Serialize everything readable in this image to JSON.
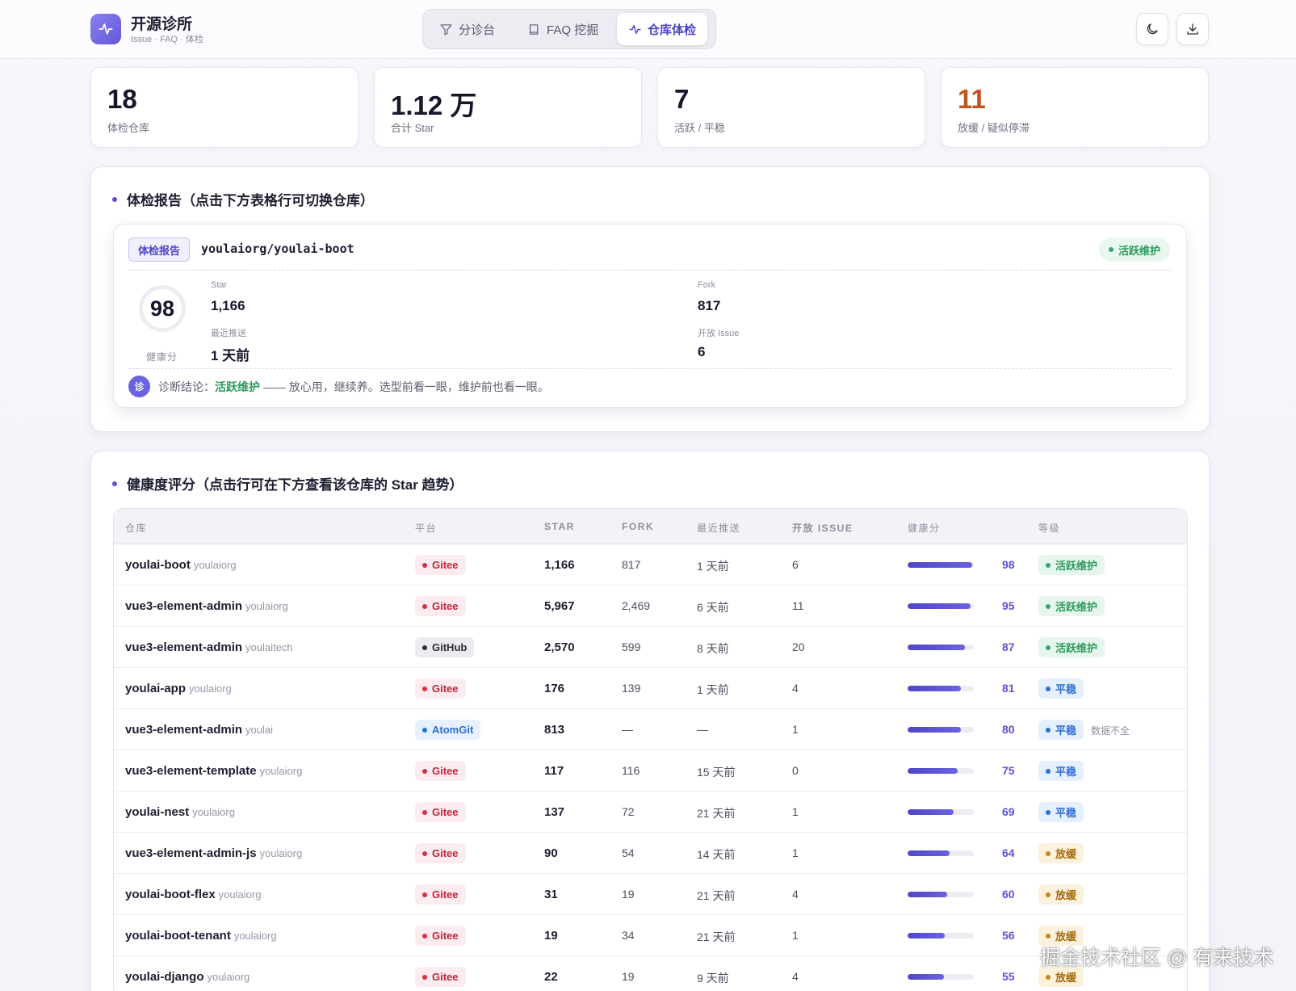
{
  "header": {
    "brand_name": "开源诊所",
    "brand_sub": "Issue · FAQ · 体检",
    "tabs": [
      {
        "label": "分诊台",
        "icon": "filter-icon"
      },
      {
        "label": "FAQ 挖掘",
        "icon": "book-icon"
      },
      {
        "label": "仓库体检",
        "icon": "pulse-icon",
        "active": true
      }
    ]
  },
  "stats": [
    {
      "value": "18",
      "label": "体检仓库"
    },
    {
      "value": "1.12 万",
      "label": "合计 Star"
    },
    {
      "value": "7",
      "label": "活跃 / 平稳"
    },
    {
      "value": "11",
      "label": "放缓 / 疑似停滞",
      "color": "#c2521f"
    }
  ],
  "report_section": {
    "title": "体检报告（点击下方表格行可切换仓库）",
    "tag": "体检报告",
    "repo": "youlaiorg/youlai-boot",
    "status": "活跃维护",
    "score": "98",
    "score_label": "健康分",
    "metrics": {
      "star_label": "Star",
      "star": "1,166",
      "fork_label": "Fork",
      "fork": "817",
      "push_label": "最近推送",
      "push": "1 天前",
      "issue_label": "开放 Issue",
      "issue": "6"
    },
    "diag_icon": "诊",
    "diag_prefix": "诊断结论：",
    "diag_highlight": "活跃维护",
    "diag_text": " —— 放心用，继续养。选型前看一眼，维护前也看一眼。"
  },
  "table_section": {
    "title": "健康度评分（点击行可在下方查看该仓库的 Star 趋势）",
    "columns": [
      "仓库",
      "平台",
      "STAR",
      "FORK",
      "最近推送",
      "开放 ISSUE",
      "健康分",
      "等级"
    ],
    "rows": [
      {
        "repo": "youlai-boot",
        "owner": "youlaiorg",
        "platform": "Gitee",
        "star": "1,166",
        "fork": "817",
        "push": "1 天前",
        "issue": "6",
        "score": 98,
        "grade": "活跃维护",
        "grade_type": "active",
        "note": ""
      },
      {
        "repo": "vue3-element-admin",
        "owner": "youlaiorg",
        "platform": "Gitee",
        "star": "5,967",
        "fork": "2,469",
        "push": "6 天前",
        "issue": "11",
        "score": 95,
        "grade": "活跃维护",
        "grade_type": "active",
        "note": ""
      },
      {
        "repo": "vue3-element-admin",
        "owner": "youlaitech",
        "platform": "GitHub",
        "star": "2,570",
        "fork": "599",
        "push": "8 天前",
        "issue": "20",
        "score": 87,
        "grade": "活跃维护",
        "grade_type": "active",
        "note": ""
      },
      {
        "repo": "youlai-app",
        "owner": "youlaiorg",
        "platform": "Gitee",
        "star": "176",
        "fork": "139",
        "push": "1 天前",
        "issue": "4",
        "score": 81,
        "grade": "平稳",
        "grade_type": "stable",
        "note": ""
      },
      {
        "repo": "vue3-element-admin",
        "owner": "youlai",
        "platform": "AtomGit",
        "star": "813",
        "fork": "—",
        "push": "—",
        "issue": "1",
        "score": 80,
        "grade": "平稳",
        "grade_type": "stable",
        "note": "数据不全"
      },
      {
        "repo": "vue3-element-template",
        "owner": "youlaiorg",
        "platform": "Gitee",
        "star": "117",
        "fork": "116",
        "push": "15 天前",
        "issue": "0",
        "score": 75,
        "grade": "平稳",
        "grade_type": "stable",
        "note": ""
      },
      {
        "repo": "youlai-nest",
        "owner": "youlaiorg",
        "platform": "Gitee",
        "star": "137",
        "fork": "72",
        "push": "21 天前",
        "issue": "1",
        "score": 69,
        "grade": "平稳",
        "grade_type": "stable",
        "note": ""
      },
      {
        "repo": "vue3-element-admin-js",
        "owner": "youlaiorg",
        "platform": "Gitee",
        "star": "90",
        "fork": "54",
        "push": "14 天前",
        "issue": "1",
        "score": 64,
        "grade": "放缓",
        "grade_type": "slow",
        "note": ""
      },
      {
        "repo": "youlai-boot-flex",
        "owner": "youlaiorg",
        "platform": "Gitee",
        "star": "31",
        "fork": "19",
        "push": "21 天前",
        "issue": "4",
        "score": 60,
        "grade": "放缓",
        "grade_type": "slow",
        "note": ""
      },
      {
        "repo": "youlai-boot-tenant",
        "owner": "youlaiorg",
        "platform": "Gitee",
        "star": "19",
        "fork": "34",
        "push": "21 天前",
        "issue": "1",
        "score": 56,
        "grade": "放缓",
        "grade_type": "slow",
        "note": ""
      },
      {
        "repo": "youlai-django",
        "owner": "youlaiorg",
        "platform": "Gitee",
        "star": "22",
        "fork": "19",
        "push": "9 天前",
        "issue": "4",
        "score": 55,
        "grade": "放缓",
        "grade_type": "slow",
        "note": ""
      }
    ]
  },
  "watermark": "掘金技术社区 @ 有来技术"
}
